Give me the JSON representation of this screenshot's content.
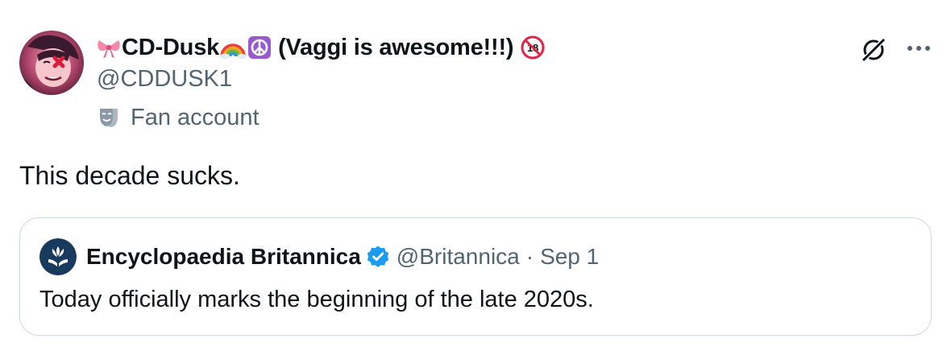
{
  "post": {
    "author": {
      "name_prefix_emoji": "bow-emoji",
      "name": "CD-Dusk",
      "name_suffix_emojis": [
        "rainbow-emoji",
        "peace-symbol-emoji"
      ],
      "name_note": "(Vaggi is awesome!!!)",
      "trailing_emoji": "no-one-under-18-emoji",
      "handle": "@CDDUSK1",
      "account_label": "Fan account",
      "account_label_icon": "theater-mask-icon"
    },
    "text": "This decade sucks.",
    "actions": {
      "grok_icon": "grok-icon",
      "more_icon": "more-options-icon"
    }
  },
  "quote": {
    "author_name": "Encyclopaedia Britannica",
    "verified": true,
    "handle": "@Britannica",
    "separator": "·",
    "date": "Sep 1",
    "text": "Today officially marks the beginning of the late 2020s."
  },
  "colors": {
    "text_primary": "#0f1419",
    "text_secondary": "#536471",
    "border": "#cfd9de",
    "verified_blue": "#1d9bf0",
    "britannica_navy": "#173a5e"
  }
}
